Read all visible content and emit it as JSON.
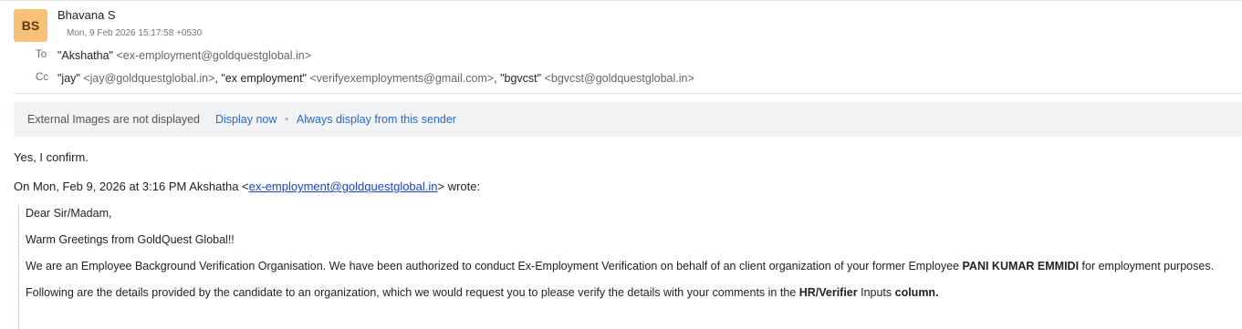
{
  "sender": {
    "initials": "BS",
    "name": "Bhavana S",
    "date": "Mon, 9 Feb 2026 15:17:58 +0530"
  },
  "to": {
    "label": "To",
    "recipients": [
      {
        "name": "\"Akshatha\"",
        "email": "<ex-employment@goldquestglobal.in>"
      }
    ]
  },
  "cc": {
    "label": "Cc",
    "recipients": [
      {
        "name": "\"jay\"",
        "email": "<jay@goldquestglobal.in>",
        "sep": ", "
      },
      {
        "name": "\"ex employment\"",
        "email": "<verifyexemployments@gmail.com>",
        "sep": ", "
      },
      {
        "name": "\"bgvcst\"",
        "email": "<bgvcst@goldquestglobal.in>",
        "sep": ""
      }
    ]
  },
  "external_images": {
    "text": "External Images are not displayed",
    "display_now": "Display now",
    "separator": "•",
    "always_display": "Always display from this sender"
  },
  "message": {
    "reply": "Yes, I confirm.",
    "quote_prefix": "On Mon, Feb 9, 2026 at 3:16 PM Akshatha <",
    "quote_link": "ex-employment@goldquestglobal.in",
    "quote_suffix": "> wrote:",
    "quoted": {
      "greeting": "Dear Sir/Madam,",
      "warm": "Warm Greetings from GoldQuest Global!!",
      "para1_a": "We are an Employee Background Verification Organisation. We have been authorized to conduct Ex-Employment Verification on behalf of an client organization of your former Employee ",
      "para1_name": "PANI KUMAR EMMIDI",
      "para1_b": "  for employment purposes.",
      "para2_a": "Following are the details provided by the candidate to an organization, which we would request you to please verify the details with your comments in the ",
      "para2_b": "HR/Verifier",
      "para2_c": " Inputs ",
      "para2_d": "column."
    }
  }
}
